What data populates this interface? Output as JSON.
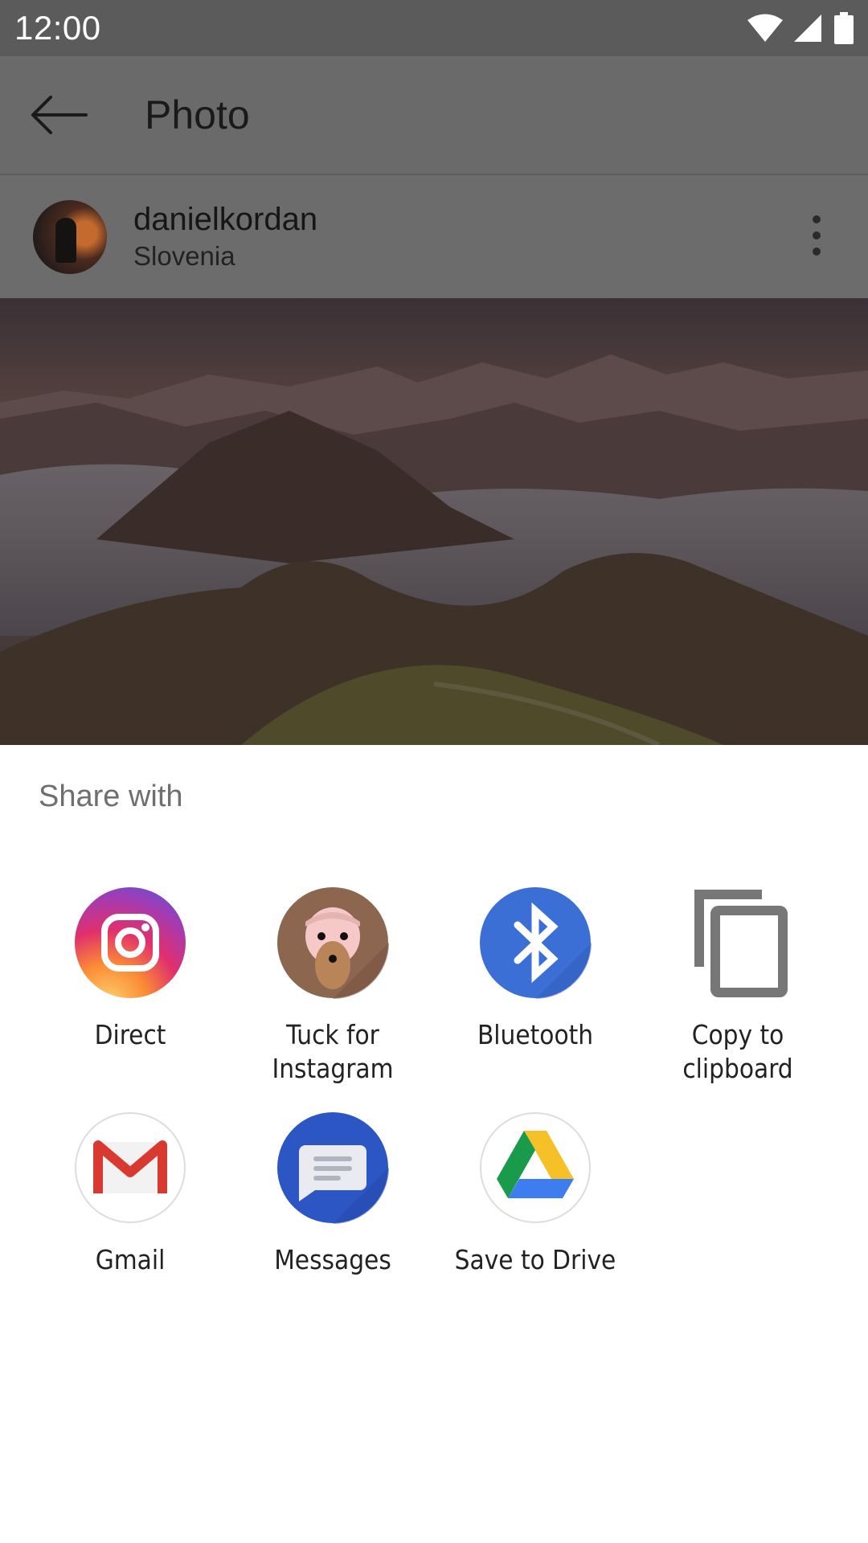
{
  "status_bar": {
    "time": "12:00"
  },
  "app_bar": {
    "title": "Photo"
  },
  "post": {
    "username": "danielkordan",
    "location": "Slovenia"
  },
  "share_sheet": {
    "heading": "Share with",
    "apps": [
      {
        "label": "Direct",
        "icon": "instagram-icon"
      },
      {
        "label": "Tuck for\nInstagram",
        "icon": "tuck-icon"
      },
      {
        "label": "Bluetooth",
        "icon": "bluetooth-icon"
      },
      {
        "label": "Copy to\nclipboard",
        "icon": "copy-icon"
      },
      {
        "label": "Gmail",
        "icon": "gmail-icon"
      },
      {
        "label": "Messages",
        "icon": "messages-icon"
      },
      {
        "label": "Save to Drive",
        "icon": "drive-icon"
      }
    ]
  },
  "colors": {
    "scrim": "#5b5b5b",
    "bluetooth": "#3b6fd6",
    "messages": "#2c56c4"
  }
}
